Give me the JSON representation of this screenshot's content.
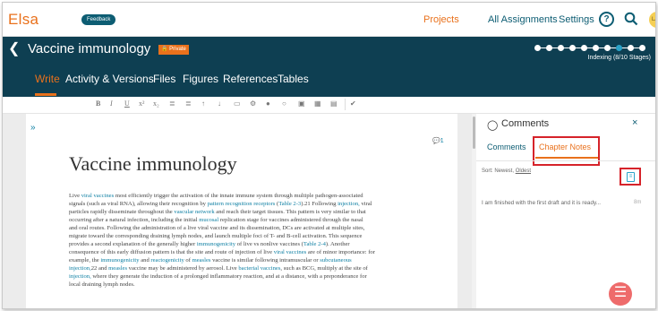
{
  "app": {
    "brand": "Elsa",
    "feedback": "Feedback"
  },
  "nav": {
    "projects": "Projects",
    "assignments": "All Assignments",
    "settings": "Settings",
    "help": "?",
    "avatar": "LAG"
  },
  "project": {
    "title": "Vaccine immunology",
    "private": "🔒 Private",
    "stage_status": "Indexing (8/10 Stages)",
    "stages_total": 10,
    "stages_done": 8
  },
  "tabs": [
    "Write",
    "Activity & Versions",
    "Files",
    "Figures",
    "References",
    "Tables"
  ],
  "toolbar": [
    "B",
    "I",
    "U",
    "x²",
    "x₂",
    "≣",
    "≣",
    "↑",
    "↓",
    "▭",
    "⚙",
    "●",
    "○",
    "▣",
    "▦",
    "▤",
    "✔"
  ],
  "editor": {
    "expand": "»",
    "comment_count": "💬1",
    "doc_title": "Vaccine immunology",
    "body_lines": [
      "Live viral vaccines most efficiently trigger the activation of the innate immune system through multiple pathogen-associated",
      "signals (such as viral RNA), allowing their recognition by pattern recognition receptors (Table 2-3).21 Following injection, viral",
      "particles rapidly disseminate throughout the vascular network and reach their target tissues. This pattern is very similar to that",
      "occurring after a natural infection, including the initial mucosal replication stage for vaccines administered through the nasal",
      "and oral routes. Following the administration of a live viral vaccine and its dissemination, DCs are activated at multiple sites,",
      "migrate toward the corresponding draining lymph nodes, and launch multiple foci of T- and B-cell activation. This sequence",
      "provides a second explanation of the generally higher immunogenicity of live vs nonlive vaccines (Table 2-4). Another",
      "consequence of this early diffusion pattern is that the site and route of injection of live viral vaccines are of minor importance: for",
      "example, the immunogenicity and reactogenicity of measles vaccine is similar following intramuscular or subcutaneous",
      "injection,22 and measles vaccine may be administered by aerosol. Live bacterial vaccines, such as BCG, multiply at the site of",
      "injection, where they generate the induction of a prolonged inflammatory reaction, and at a distance, with a preponderance for",
      "local draining lymph nodes."
    ]
  },
  "comments_panel": {
    "title": "Comments",
    "close": "×",
    "tab_comments": "Comments",
    "tab_chapter_notes": "Chapter Notes",
    "sort_label": "Sort: Newest, ",
    "sort_oldest": "Oldest",
    "note_text": "I am finished with the first draft and it is ready...",
    "note_time": "8m",
    "fab": "☰"
  },
  "colors": {
    "accent": "#e9711c",
    "header": "#0e3f52",
    "link": "#0d7fa3",
    "highlight": "#d6232a"
  }
}
